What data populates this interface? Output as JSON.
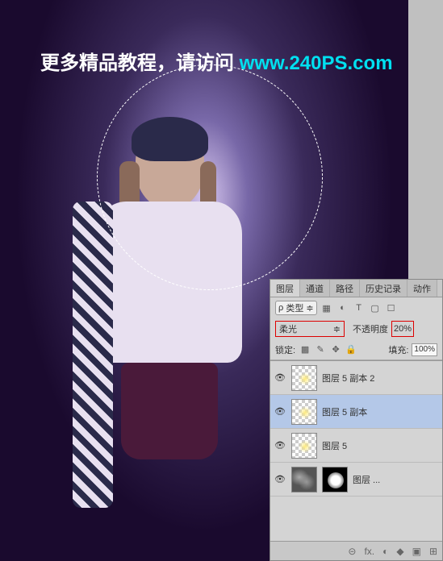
{
  "watermark": {
    "text_cn": "更多精品教程，请访问",
    "url": "www.240PS.com"
  },
  "panel": {
    "tabs": [
      "图层",
      "通道",
      "路径",
      "历史记录",
      "动作"
    ],
    "active_tab": 0,
    "filter": {
      "label": "类型",
      "symbol": "ρ"
    },
    "blend": {
      "mode": "柔光",
      "opacity_label": "不透明度",
      "opacity_value": "20%"
    },
    "lock": {
      "label": "锁定:",
      "fill_label": "填充:",
      "fill_value": "100%"
    },
    "layers": [
      {
        "name": "图层 5 副本 2",
        "visible": true,
        "selected": false,
        "thumb": "glow",
        "mask": false
      },
      {
        "name": "图层 5 副本",
        "visible": true,
        "selected": true,
        "thumb": "glow",
        "mask": false
      },
      {
        "name": "图层 5",
        "visible": true,
        "selected": false,
        "thumb": "glow",
        "mask": false
      },
      {
        "name": "图层 ...",
        "visible": true,
        "selected": false,
        "thumb": "cloud",
        "mask": true
      }
    ],
    "bottom_icons": [
      "⊝",
      "fx.",
      "◐",
      "◆",
      "▣",
      "⊞"
    ]
  }
}
